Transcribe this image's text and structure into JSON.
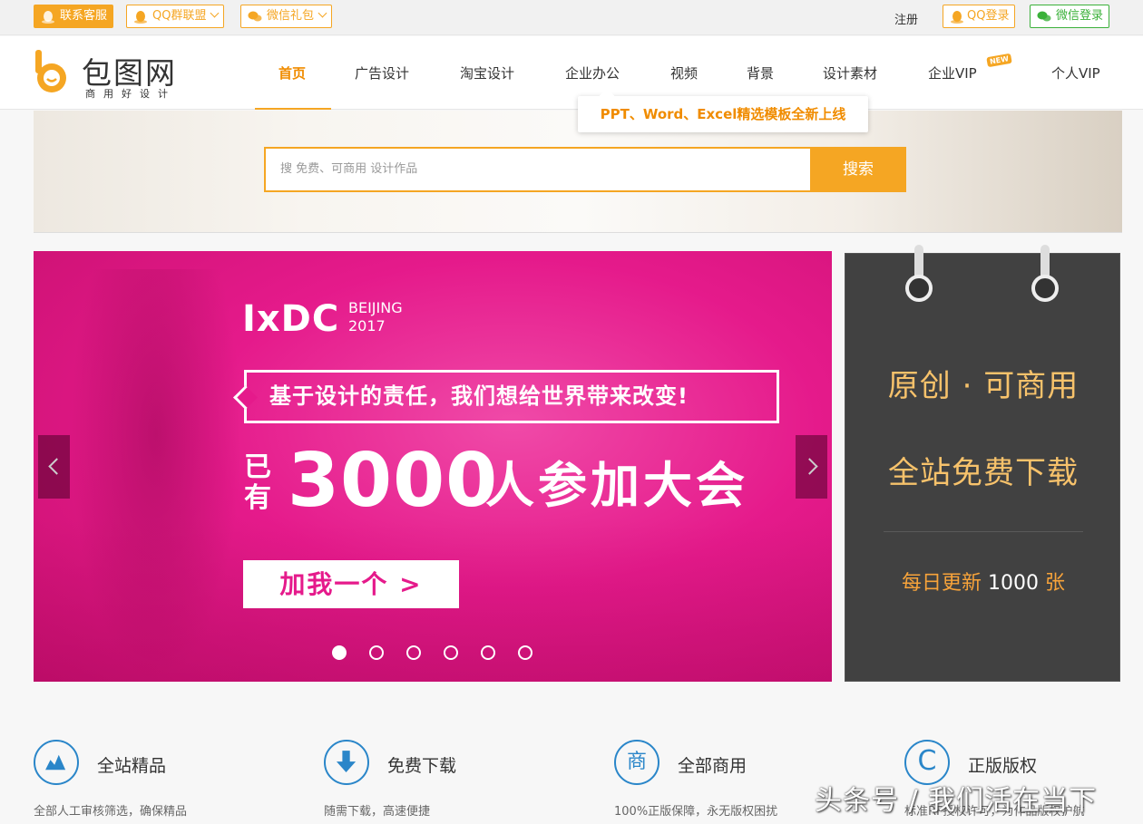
{
  "topbar": {
    "contact_service": "联系客服",
    "qq_group": "QQ群联盟",
    "wechat_gift": "微信礼包",
    "register": "注册",
    "qq_login": "QQ登录",
    "wechat_login": "微信登录"
  },
  "logo": {
    "name": "包图网",
    "slogan": "商用好设计"
  },
  "nav": {
    "items": [
      "首页",
      "广告设计",
      "淘宝设计",
      "企业办公",
      "视频",
      "背景",
      "设计素材",
      "企业VIP",
      "个人VIP"
    ],
    "new_badge": "NEW",
    "tooltip": "PPT、Word、Excel精选模板全新上线"
  },
  "search": {
    "placeholder": "搜 免费、可商用 设计作品",
    "button": "搜索"
  },
  "hero": {
    "brand": "IxDC",
    "city": "BEIJING",
    "year": "2017",
    "slogan": "基于设计的责任，我们想给世界带来改变!",
    "pre": "已有",
    "number": "3000",
    "text": "人参加大会",
    "cta": "加我一个 >",
    "slide_count": 6,
    "active_slide": 1
  },
  "side_panel": {
    "line1": "原创 · 可商用",
    "line2": "全站免费下载",
    "line3_prefix": "每日更新",
    "line3_number": "1000",
    "line3_suffix": "张"
  },
  "features": [
    {
      "title": "全站精品",
      "desc": "全部人工审核筛选，确保精品",
      "icon": "quality-icon"
    },
    {
      "title": "免费下载",
      "desc": "随需下载，高速便捷",
      "icon": "download-icon"
    },
    {
      "title": "全部商用",
      "desc": "100%正版保障，永无版权困扰",
      "icon": "commercial-icon",
      "glyph": "商"
    },
    {
      "title": "正版版权",
      "desc": "标准RF授权许可，为作品版权护航",
      "icon": "copyright-icon",
      "glyph": "C"
    }
  ],
  "watermark": "头条号 / 我们活在当下",
  "colors": {
    "accent": "#f5a623",
    "hero_pink": "#e51a8b",
    "side_panel": "#414141",
    "feature_blue": "#2a86c9",
    "wechat_green": "#3bb13a"
  }
}
